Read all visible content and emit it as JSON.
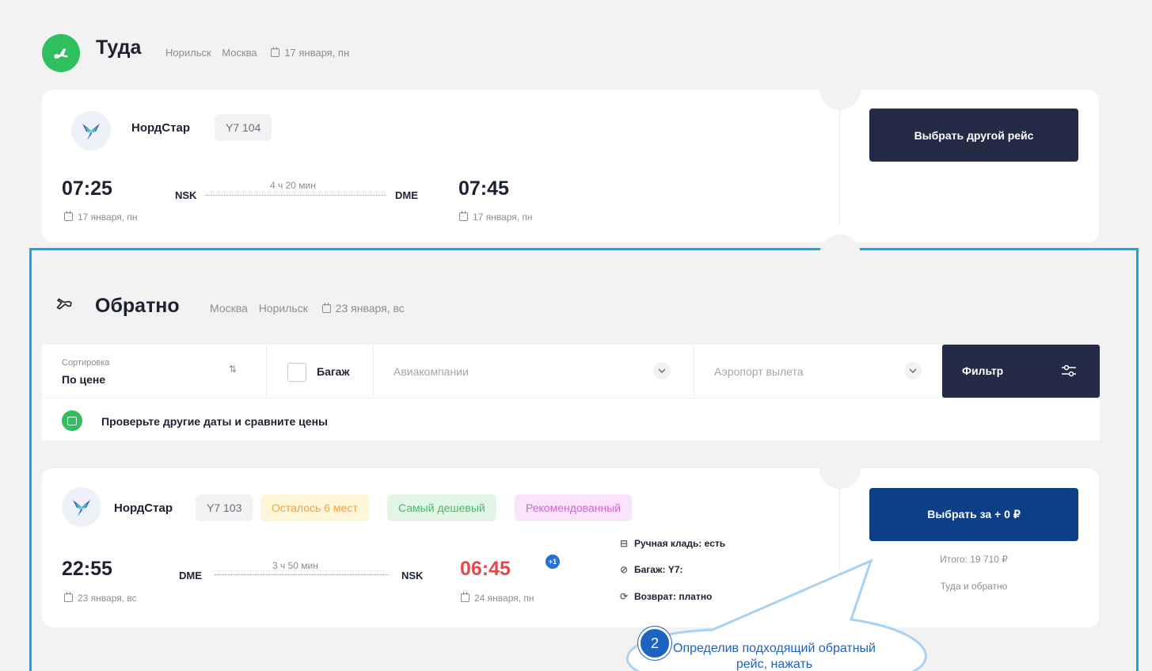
{
  "outbound": {
    "title": "Туда",
    "from": "Норильск",
    "to": "Москва",
    "date": "17 января, пн",
    "airline": "НордСтар",
    "flight_no": "Y7 104",
    "duration": "4 ч 20 мин",
    "dep_time": "07:25",
    "dep_code": "NSK",
    "dep_date": "17 января, пн",
    "arr_time": "07:45",
    "arr_code": "DME",
    "arr_date": "17 января, пн",
    "action_label": "Выбрать другой рейс"
  },
  "inbound": {
    "title": "Обратно",
    "from": "Москва",
    "to": "Норильск",
    "date": "23 января, вс"
  },
  "filters": {
    "sort_caption": "Сортировка",
    "sort_value": "По цене",
    "baggage_label": "Багаж",
    "airlines_placeholder": "Авиакомпании",
    "airport_placeholder": "Аэропорт вылета",
    "filter_label": "Фильтр"
  },
  "date_hint": "Проверьте другие даты и сравните цены",
  "offer": {
    "airline": "НордСтар",
    "flight_no": "Y7 103",
    "badges": [
      "Осталось 6 мест",
      "Самый дешевый",
      "Рекомендованный"
    ],
    "duration": "3 ч 50 мин",
    "dep_time": "22:55",
    "dep_code": "DME",
    "dep_date": "23 января, вс",
    "arr_time": "06:45",
    "arr_code": "NSK",
    "arr_date": "24 января, пн",
    "next_day_badge": "+1",
    "hand_luggage": "Ручная кладь: есть",
    "baggage": "Багаж: Y7:",
    "refund": "Возврат: платно",
    "select_label": "Выбрать за + 0 ₽",
    "total": "Итого: 19 710 ₽",
    "trip_type": "Туда и обратно"
  },
  "callout": {
    "step": "2",
    "text": "Определив подходящий обратный рейс, нажать"
  },
  "colors": {
    "dark_navy": "#242b46",
    "primary_blue": "#0d3f86",
    "accent_green": "#2fbf5f",
    "highlight_border": "#12a8e8",
    "price_red": "#e5484d"
  }
}
